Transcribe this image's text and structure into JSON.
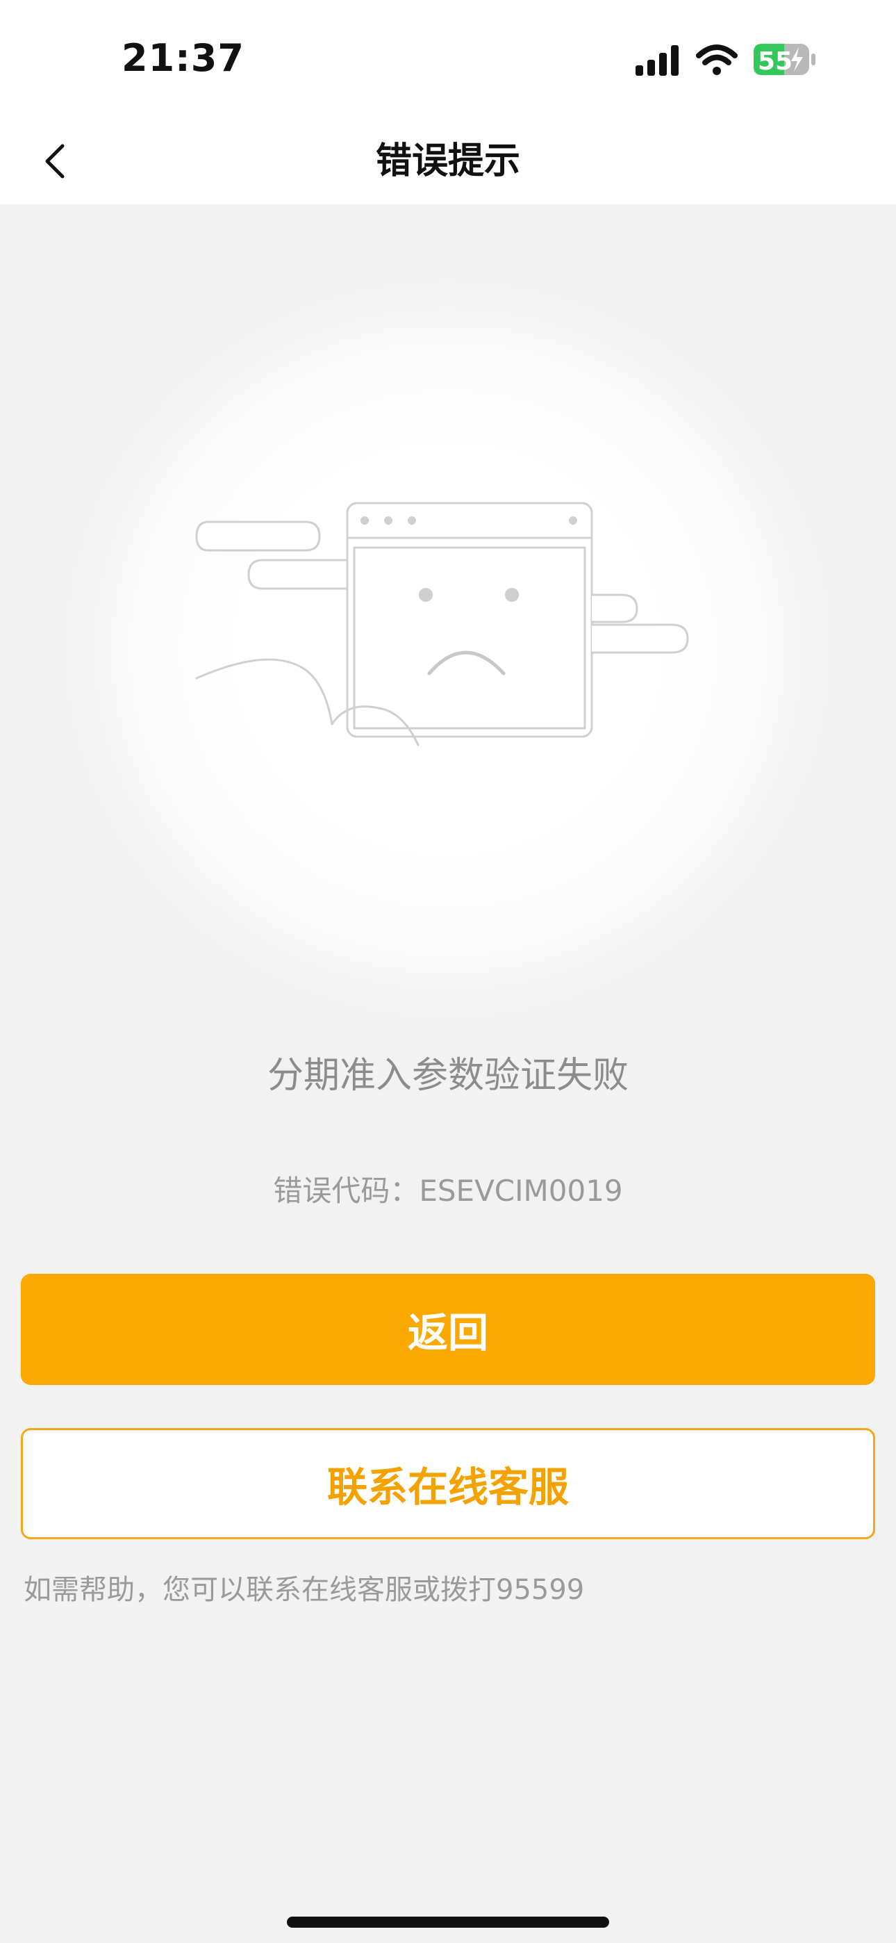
{
  "status_bar": {
    "time": "21:37",
    "battery_level": "55",
    "icons": [
      "signal-icon",
      "wifi-icon",
      "battery-charging-icon"
    ]
  },
  "nav": {
    "back_icon": "chevron-left-icon",
    "title": "错误提示"
  },
  "error": {
    "illustration_icon": "sad-browser-window-icon",
    "message": "分期准入参数验证失败",
    "code_text": "错误代码：ESEVCIM0019"
  },
  "actions": {
    "return_label": "返回",
    "contact_label": "联系在线客服"
  },
  "help": {
    "text": "如需帮助，您可以联系在线客服或拨打95599"
  },
  "colors": {
    "accent": "#fba800",
    "background": "#f2f2f2",
    "battery_green": "#34c759"
  }
}
